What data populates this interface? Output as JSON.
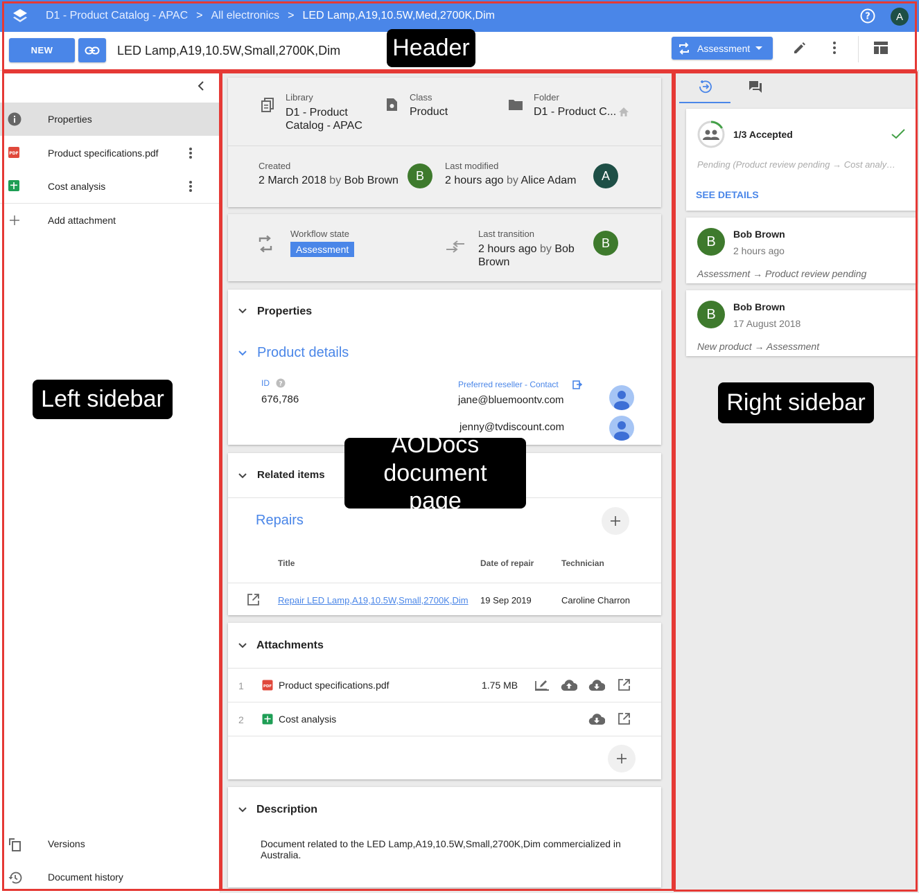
{
  "topbar": {
    "breadcrumbs": [
      "D1 - Product Catalog - APAC",
      "All electronics",
      "LED Lamp,A19,10.5W,Med,2700K,Dim"
    ],
    "separator": ">",
    "user_initial": "A",
    "color": "#4a86e8"
  },
  "toolbar": {
    "new_label": "NEW",
    "doc_title": "LED Lamp,A19,10.5W,Small,2700K,Dim",
    "workflow_button": "Assessment"
  },
  "left_sidebar": {
    "items": [
      {
        "label": "Properties",
        "icon": "info-icon"
      },
      {
        "label": "Product specifications.pdf",
        "icon": "pdf-icon"
      },
      {
        "label": "Cost analysis",
        "icon": "sheets-icon"
      },
      {
        "label": "Add attachment",
        "icon": "plus-icon"
      }
    ],
    "bottom_items": [
      {
        "label": "Versions",
        "icon": "versions-icon"
      },
      {
        "label": "Document history",
        "icon": "history-icon"
      }
    ]
  },
  "document": {
    "location": {
      "library_label": "Library",
      "library_value": "D1 - Product Catalog - APAC",
      "class_label": "Class",
      "class_value": "Product",
      "folder_label": "Folder",
      "folder_value": "D1 - Product C..."
    },
    "dates": {
      "created_label": "Created",
      "created_date": "2 March 2018",
      "created_by_word": "by",
      "created_by": "Bob Brown",
      "created_initial": "B",
      "modified_label": "Last modified",
      "modified_date": "2 hours ago",
      "modified_by_word": "by",
      "modified_by": "Alice Adam",
      "modified_initial": "A"
    },
    "workflow": {
      "state_label": "Workflow state",
      "state_value": "Assessment",
      "transition_label": "Last transition",
      "transition_when": "2 hours ago",
      "by_word": "by",
      "transition_by": "Bob Brown",
      "transition_initial": "B"
    },
    "properties": {
      "title": "Properties",
      "group_title": "Product details",
      "id_label": "ID",
      "id_value": "676,786",
      "reseller_label": "Preferred reseller - Contact",
      "contacts": [
        "jane@bluemoontv.com",
        "jenny@tvdiscount.com"
      ]
    },
    "related": {
      "title": "Related items",
      "group_title": "Repairs",
      "columns": [
        "Title",
        "Date of repair",
        "Technician"
      ],
      "rows": [
        {
          "title": "Repair LED Lamp,A19,10.5W,Small,2700K,Dim",
          "date": "19 Sep 2019",
          "technician": "Caroline Charron"
        }
      ]
    },
    "attachments": {
      "title": "Attachments",
      "items": [
        {
          "index": "1",
          "name": "Product specifications.pdf",
          "size": "1.75 MB"
        },
        {
          "index": "2",
          "name": "Cost analysis",
          "size": ""
        }
      ]
    },
    "description": {
      "title": "Description",
      "text": "Document related to the LED Lamp,A19,10.5W,Small,2700K,Dim commercialized in Australia."
    }
  },
  "right_sidebar": {
    "approval": {
      "status": "1/3 Accepted",
      "pending": "Pending (Product review pending → Cost analy…",
      "details_label": "SEE DETAILS"
    },
    "history": [
      {
        "initial": "B",
        "name": "Bob Brown",
        "when": "2 hours ago",
        "transition": "Assessment → Product review pending"
      },
      {
        "initial": "B",
        "name": "Bob Brown",
        "when": "17 August 2018",
        "transition": "New product → Assessment"
      }
    ]
  },
  "annotations": {
    "header": "Header",
    "left_sidebar": "Left sidebar",
    "document_page": "AODocs document page",
    "right_sidebar": "Right sidebar",
    "box_color": "#e53935"
  }
}
